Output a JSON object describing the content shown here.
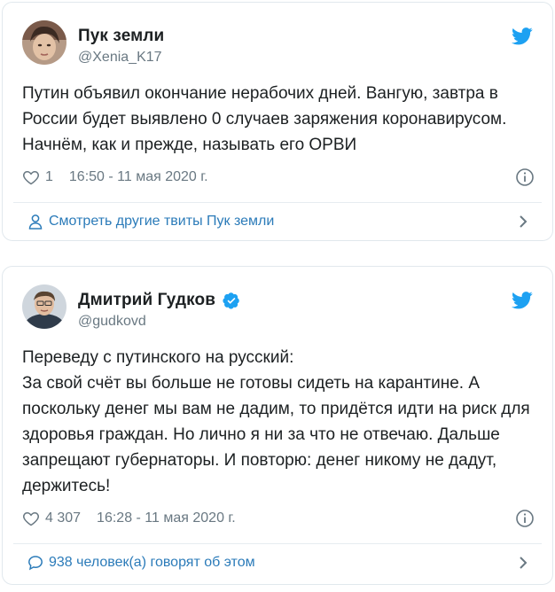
{
  "tweets": [
    {
      "author": {
        "name": "Пук земли",
        "handle": "@Xenia_K17",
        "verified": false
      },
      "text": "Путин объявил окончание нерабочих дней. Вангую, завтра в России будет выявлено 0 случаев заряжения коронавирусом. Начнём, как и прежде, называть его ОРВИ",
      "likes": "1",
      "timestamp": "16:50 - 11 мая 2020 г.",
      "footer": {
        "icon": "person-icon",
        "label": "Смотреть другие твиты Пук земли"
      }
    },
    {
      "author": {
        "name": "Дмитрий Гудков",
        "handle": "@gudkovd",
        "verified": true
      },
      "text": "Переведу с путинского на русский:\nЗа свой счёт вы больше не готовы сидеть на карантине. А поскольку денег мы вам не дадим, то придётся идти на риск для здоровья граждан. Но лично я ни за что не отвечаю. Дальше запрещают губернаторы. И повторю: денег никому не дадут, держитесь!",
      "likes": "4 307",
      "timestamp": "16:28 - 11 мая 2020 г.",
      "footer": {
        "icon": "speech-bubble-icon",
        "label": "938 человек(а) говорят об этом"
      }
    }
  ],
  "colors": {
    "twitter_blue": "#1da1f2",
    "link_blue": "#2b7bb9",
    "secondary_text": "#697882",
    "border": "#e1e8ed"
  }
}
